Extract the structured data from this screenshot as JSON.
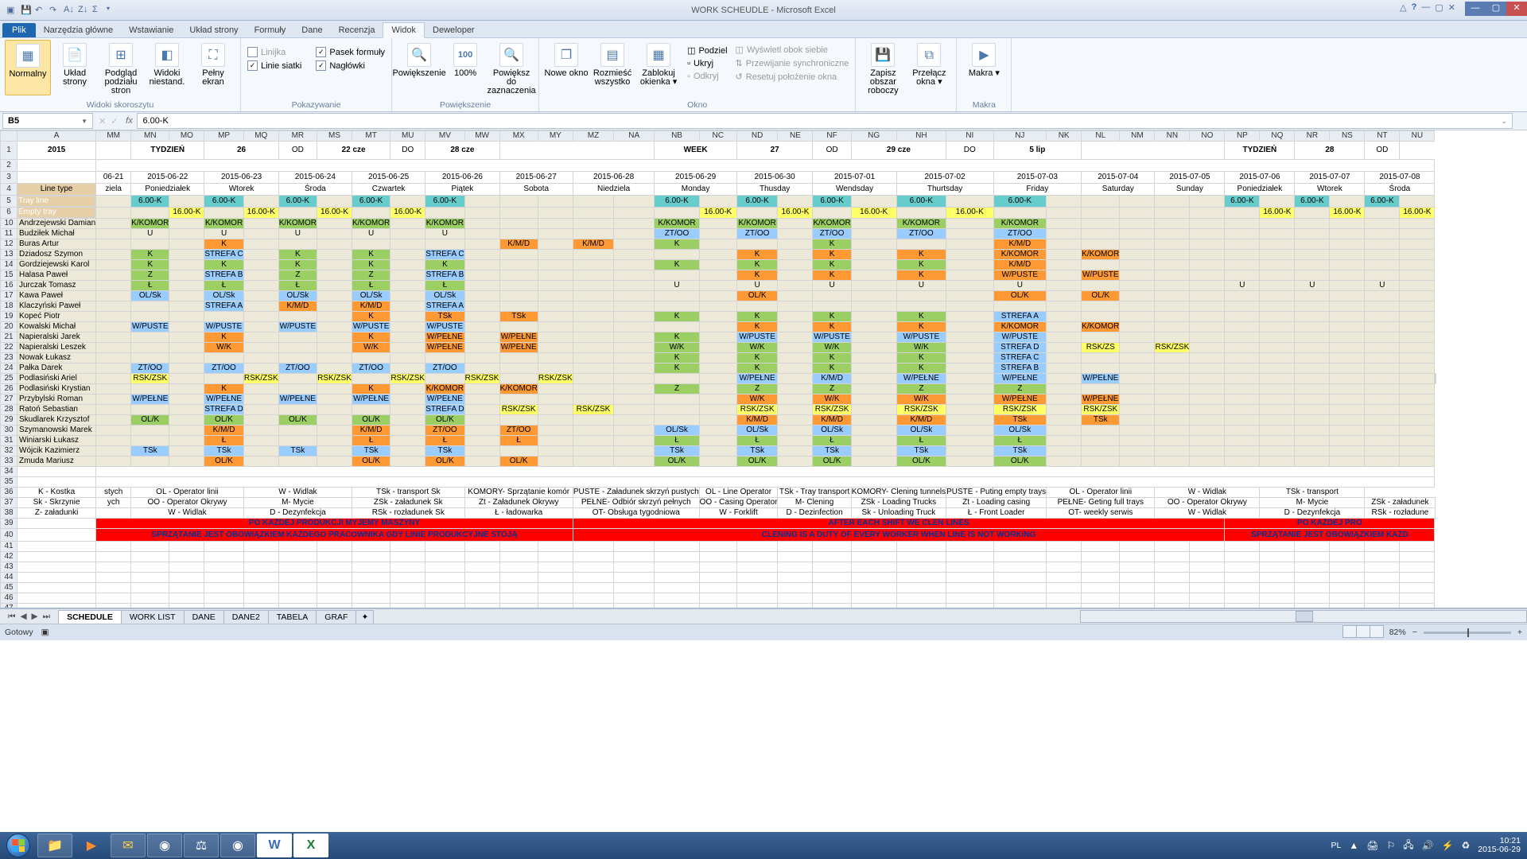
{
  "app": {
    "title": "WORK SCHEUDLE - Microsoft Excel"
  },
  "tabs": {
    "file": "Plik",
    "items": [
      "Narzędzia główne",
      "Wstawianie",
      "Układ strony",
      "Formuły",
      "Dane",
      "Recenzja",
      "Widok",
      "Deweloper"
    ],
    "active": "Widok"
  },
  "ribbon": {
    "g1": {
      "label": "Widoki skoroszytu",
      "btns": [
        "Normalny",
        "Układ strony",
        "Podgląd podziału stron",
        "Widoki niestand.",
        "Pełny ekran"
      ]
    },
    "g2": {
      "label": "Pokazywanie",
      "chk": [
        [
          "Linijka",
          false
        ],
        [
          "Linie siatki",
          true
        ],
        [
          "Pasek formuły",
          true
        ],
        [
          "Nagłówki",
          true
        ]
      ]
    },
    "g3": {
      "label": "Powiększenie",
      "btns": [
        "Powiększenie",
        "100%",
        "Powiększ do zaznaczenia"
      ]
    },
    "g4": {
      "label": "Okno",
      "big": [
        "Nowe okno",
        "Rozmieść wszystko",
        "Zablokuj okienka ▾"
      ],
      "small": [
        "Podziel",
        "Ukryj",
        "Odkryj",
        "Wyświetl obok siebie",
        "Przewijanie synchroniczne",
        "Resetuj położenie okna"
      ]
    },
    "g5": {
      "btns": [
        "Zapisz obszar roboczy",
        "Przełącz okna ▾"
      ]
    },
    "g6": {
      "label": "Makra",
      "btns": [
        "Makra ▾"
      ]
    }
  },
  "nameBox": "B5",
  "formula": "6.00-K",
  "cols": [
    "",
    "A",
    "MM",
    "MN",
    "MO",
    "MP",
    "MQ",
    "MR",
    "MS",
    "MT",
    "MU",
    "MV",
    "MW",
    "MX",
    "MY",
    "MZ",
    "NA",
    "NB",
    "NC",
    "ND",
    "NE",
    "NF",
    "NG",
    "NH",
    "NI",
    "NJ",
    "NK",
    "NL",
    "NM",
    "NN",
    "NO",
    "NP",
    "NQ",
    "NR",
    "NS",
    "NT",
    "NU"
  ],
  "row1": {
    "year": "2015",
    "tydz": "TYDZIEŃ",
    "d1": "26",
    "od1": "OD",
    "dt1": "22 cze",
    "do1": "DO",
    "dt2": "28 cze",
    "week": "WEEK",
    "d2": "27",
    "od2": "OD",
    "dt3": "29 cze",
    "do2": "DO",
    "dt4": "5 lip",
    "tydz2": "TYDZIEŃ",
    "d3": "28",
    "od3": "OD"
  },
  "row3": [
    "06-21",
    "2015-06-22",
    "2015-06-23",
    "2015-06-24",
    "2015-06-25",
    "2015-06-26",
    "2015-06-27",
    "2015-06-28",
    "2015-06-29",
    "2015-06-30",
    "2015-07-01",
    "2015-07-02",
    "2015-07-03",
    "2015-07-04",
    "2015-07-05",
    "2015-07-06",
    "2015-07-07",
    "2015-07-08"
  ],
  "row4": {
    "lbl": "Line type",
    "days": [
      "ziela",
      "Poniedziałek",
      "Wtorek",
      "Środa",
      "Czwartek",
      "Piątek",
      "Sobota",
      "Niedziela",
      "Monday",
      "Thusday",
      "Wendsday",
      "Thurtsday",
      "Friday",
      "Saturday",
      "Sunday",
      "Poniedziałek",
      "Wtorek",
      "Środa"
    ]
  },
  "row5": {
    "lbl": "Tray line",
    "v": "6.00-K"
  },
  "row6": {
    "lbl": "Empty tray",
    "v": "16.00-K"
  },
  "names": [
    "Andrzejewski Damian",
    "Budziłek Michał",
    "Buras Artur",
    "Dziadosz Szymon",
    "Gordziejewski Karol",
    "Halasa Paweł",
    "Jurczak Tomasz",
    "Kawa Paweł",
    "Klaczyński Paweł",
    "Kopeć Piotr",
    "Kowalski Michał",
    "Napieralski Jarek",
    "Napieralski Leszek",
    "Nowak Łukasz",
    "Pałka Darek",
    "Podlasiński Ariel",
    "Podlasiński Krystian",
    "Przybylski Roman",
    "Ratoń Sebastian",
    "Skudlarek Krzysztof",
    "Szymanowski Marek",
    "Winiarski Łukasz",
    "Wójcik Kazimierz",
    "Żmuda Mariusz"
  ],
  "codes": {
    "KK": "K/KOMOR",
    "U": "U",
    "K": "K",
    "KMD": "K/M/D",
    "SC": "STREFA C",
    "SB": "STREFA B",
    "SA": "STREFA A",
    "SD": "STREFA D",
    "Z": "Z",
    "L": "Ł",
    "OLS": "OL/Sk",
    "ZTOO": "ZT/OO",
    "WPU": "W/PUSTE",
    "WK": "W/K",
    "WPE": "W/PEŁNE",
    "RSK": "RSK/ZSK",
    "OLK": "OL/K",
    "TSK": "TSk",
    "RSKZS": "RSK/ZS"
  },
  "legend": {
    "h1": [
      "K - Kostka",
      "stych",
      "OL - Operator linii",
      "W - Widlak",
      "TSk - transport Sk",
      "KOMORY- Sprzątanie komór",
      "PUSTE - Załadunek skrzyń pustych",
      "OL - Line Operator",
      "TSk - Tray transport",
      "KOMORY- Clening tunnels",
      "PUSTE - Puting  empty trays",
      "OL - Operator linii",
      "W - Widlak",
      "TSk - transport"
    ],
    "h2": [
      "Sk - Skrzynie",
      "ych",
      "OO - Operator Okrywy",
      "M- Mycie",
      "ZSk - załadunek Sk",
      "Zt - Załadunek Okrywy",
      "PEŁNE- Odbiór skrzyń pełnych",
      "OO - Casing Operator",
      "M- Clening",
      "ZSk - Loading Trucks",
      "Zt - Loading casing",
      "PEŁNE- Geting full trays",
      "OO - Operator Okrywy",
      "M- Mycie",
      "ZSk - załadunek"
    ],
    "h3": [
      "Z- załadunki",
      "",
      "W - Widlak",
      "D - Dezynfekcja",
      "RSk - rozładunek Sk",
      "Ł - ładowarka",
      "OT- Obsługa tygodniowa",
      "W - Forklift",
      "D - Dezinfection",
      "Sk - Unloading Truck",
      "Ł - Front Loader",
      "OT- weekly serwis",
      "W - Widlak",
      "D - Dezynfekcja",
      "RSk - rozładune"
    ]
  },
  "red1a": "PO KAŻDEJ PRODUKCJI MYJEMY MASZYNY",
  "red1b": "AFTER EACH SHIFT WE CLEN LINES",
  "red1c": "PO KAŻDEJ PRO",
  "red2a": "SPRZĄTANIE JEST OBOWIĄZKIEM KAŻDEGO PRACOWNIKA GDY LINIE PRODUKCYJNE STOJĄ",
  "red2b": "CLENING IS A DUTY OF EVERY WORKER WHEN LINE IS NOT WORKING",
  "red2c": "SPRZĄTANIE JEST OBOWIĄZKIEM KAŻD",
  "sheetTabs": [
    "SCHEDULE",
    "WORK LIST",
    "DANE",
    "DANE2",
    "TABELA",
    "GRAF"
  ],
  "status": {
    "ready": "Gotowy",
    "zoom": "82%",
    "lang": "PL"
  },
  "clock": {
    "time": "10:21",
    "date": "2015-06-29"
  }
}
